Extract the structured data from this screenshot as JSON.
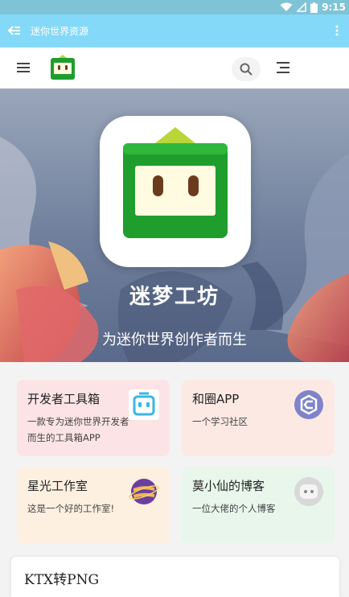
{
  "status_bar": {
    "time": "9:15"
  },
  "app_bar": {
    "title": "迷你世界资源"
  },
  "hero": {
    "app_name": "迷梦工坊",
    "slogan": "为迷你世界创作者而生"
  },
  "cards": [
    {
      "title": "开发者工具箱",
      "desc": "一款专为迷你世界开发者而生的工具箱APP",
      "bg": "#fce4e6",
      "icon": "robot-icon"
    },
    {
      "title": "和圈APP",
      "desc": "一个学习社区",
      "bg": "#fde9e4",
      "icon": "hequan-logo-icon"
    },
    {
      "title": "星光工作室",
      "desc": "这是一个好的工作室!",
      "bg": "#fdf0e1",
      "icon": "planet-icon"
    },
    {
      "title": "莫小仙的博客",
      "desc": "一位大佬的个人博客",
      "bg": "#e8f6ec",
      "icon": "robot-avatar-icon"
    }
  ],
  "bottom_card": {
    "title": "KTX转PNG"
  },
  "colors": {
    "app_bar": "#85d9f8",
    "accent_green": "#1f9e2d"
  }
}
